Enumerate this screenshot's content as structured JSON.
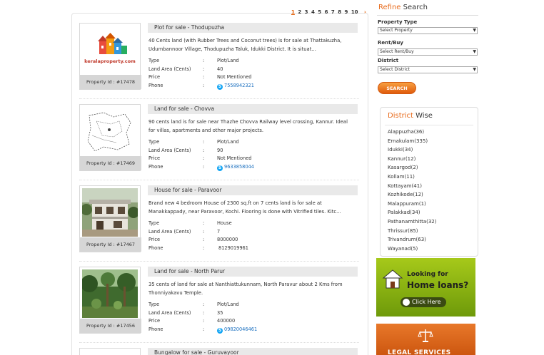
{
  "pagination": {
    "pages": [
      "1",
      "2",
      "3",
      "4",
      "5",
      "6",
      "7",
      "8",
      "9",
      "10"
    ],
    "current": "1",
    "next": "›"
  },
  "listings": [
    {
      "title": "Plot for sale - Thodupuzha",
      "description": "40 Cents land (with Rubber Trees and Coconut trees) is for sale at Thattakuzha, Udumbannoor Village, Thodupuzha Taluk, Idukki District. It is situat...",
      "property_id": "Property Id : #17478",
      "thumb_logo": "keralaproperty.com",
      "type": "Plot/Land",
      "land_area": "40",
      "price": "Not Mentioned",
      "phone": "7558942321",
      "phone_skype": true
    },
    {
      "title": "Land for sale - Chovva",
      "description": "90 cents land is for sale near Thazhe Chovva Railway level crossing, Kannur. Ideal for villas, apartments and other major projects.",
      "property_id": "Property Id : #17469",
      "type": "Plot/Land",
      "land_area": "90",
      "price": "Not Mentioned",
      "phone": "9633858044",
      "phone_skype": true
    },
    {
      "title": "House for sale - Paravoor",
      "description": "Brand new 4 bedroom House of 2300 sq.ft on 7 cents land is for sale at Manakkappady, near Paravoor, Kochi. Flooring is done with Vitrified tiles. Kitc...",
      "property_id": "Property Id : #17467",
      "type": "House",
      "land_area": "7",
      "price": "8000000",
      "phone": "8129019961",
      "phone_skype": false
    },
    {
      "title": "Land for sale - North Parur",
      "description": "35 cents of land for sale at Nanthiattukunnam, North Paravur about 2 Kms from Thonniyakavu Temple.",
      "property_id": "Property Id : #17456",
      "type": "Plot/Land",
      "land_area": "35",
      "price": "400000",
      "phone": "09820046461",
      "phone_skype": true
    },
    {
      "title": "Bungalow for sale - Guruvayoor"
    }
  ],
  "field_labels": {
    "type": "Type",
    "land_area": "Land Area (Cents)",
    "price": "Price",
    "phone": "Phone",
    "colon": ":"
  },
  "refine": {
    "title_accent": "Refine",
    "title_rest": " Search",
    "property_type_label": "Property Type",
    "property_type_value": "Select Property",
    "rent_buy_label": "Rent/Buy",
    "rent_buy_value": "Select Rent/Buy",
    "district_label": "District",
    "district_value": "Select District",
    "search_button": "SEARCH"
  },
  "district_wise": {
    "title_accent": "District",
    "title_rest": " Wise",
    "items": [
      "Alappuzha(36)",
      "Ernakulam(335)",
      "Idukki(34)",
      "Kannur(12)",
      "Kasargod(2)",
      "Kollam(11)",
      "Kottayam(41)",
      "Kozhikode(12)",
      "Malappuram(1)",
      "Palakkad(34)",
      "Pathanamthitta(32)",
      "Thrissur(85)",
      "Trivandrum(63)",
      "Wayanad(5)"
    ]
  },
  "ads": {
    "home_loans_line1": "Looking for",
    "home_loans_line2": "Home loans?",
    "home_loans_cta": "Click Here",
    "legal_services": "LEGAL SERVICES"
  },
  "colors": {
    "accent": "#e86a1a",
    "link": "#1a6fbf"
  }
}
